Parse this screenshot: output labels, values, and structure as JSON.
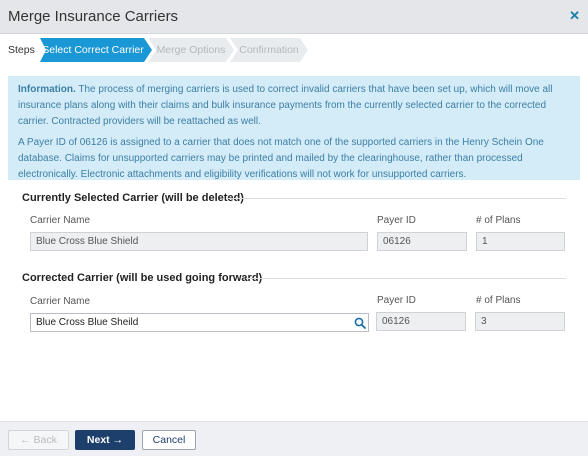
{
  "window": {
    "title": "Merge Insurance Carriers",
    "close_glyph": "✕"
  },
  "steps": {
    "label": "Steps",
    "items": [
      {
        "label": "Select Correct Carrier",
        "state": "active"
      },
      {
        "label": "Merge Options",
        "state": "disabled"
      },
      {
        "label": "Confirmation",
        "state": "disabled"
      }
    ]
  },
  "info": {
    "heading": "Information.",
    "paragraph1": " The process of merging carriers is used to correct invalid carriers that have been set up, which will move all insurance plans along with their claims and bulk insurance payments from the currently selected carrier to the corrected carrier. Contracted providers will be reattached as well.",
    "paragraph2": "A Payer ID of 06126 is assigned to a carrier that does not match one of the supported carriers in the Henry Schein One database. Claims for unsupported carriers may be printed and mailed by the clearinghouse, rather than processed electronically. Electronic attachments and eligibility verifications will not work for unsupported carriers."
  },
  "current": {
    "title": "Currently Selected Carrier (will be deleted)",
    "carrier_label": "Carrier Name",
    "payer_label": "Payer ID",
    "plans_label": "# of Plans",
    "carrier_value": "Blue Cross Blue Shield",
    "payer_value": "06126",
    "plans_value": "1"
  },
  "corrected": {
    "title": "Corrected Carrier (will be used going forward)",
    "carrier_label": "Carrier Name",
    "payer_label": "Payer ID",
    "plans_label": "# of Plans",
    "carrier_value": "Blue Cross Blue Sheild",
    "payer_value": "06126",
    "plans_value": "3"
  },
  "footer": {
    "back_label": "Back",
    "next_label": "Next",
    "cancel_label": "Cancel"
  },
  "colors": {
    "accent": "#1a97d5",
    "primary_button": "#1d3f6b",
    "info_bg": "#d4ecf7",
    "info_text": "#3c7fa6"
  }
}
